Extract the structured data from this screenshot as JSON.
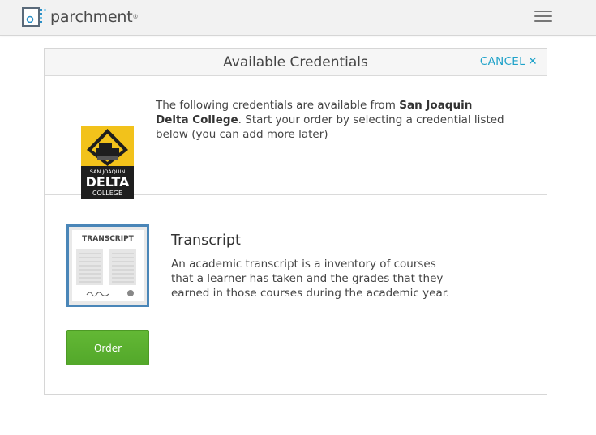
{
  "header": {
    "brand": "parchment",
    "brand_tm": "®"
  },
  "panel": {
    "title": "Available Credentials",
    "cancel_label": "CANCEL",
    "cancel_icon": "close-icon"
  },
  "school": {
    "intro_prefix": "The following credentials are available from ",
    "name": "San Joaquin Delta College",
    "intro_suffix": ". Start your order by selecting a credential listed below (you can add more later)",
    "logo_lines": [
      "SAN JOAQUIN",
      "DELTA",
      "COLLEGE"
    ]
  },
  "credential": {
    "image_label": "TRANSCRIPT",
    "title": "Transcript",
    "description": "An academic transcript is a inventory of courses that a learner has taken and the grades that they earned in those courses during the academic year.",
    "order_label": "Order"
  },
  "colors": {
    "accent": "#1fa2c9",
    "order_green": "#5cb22f",
    "frame_blue": "#4a86b8"
  }
}
